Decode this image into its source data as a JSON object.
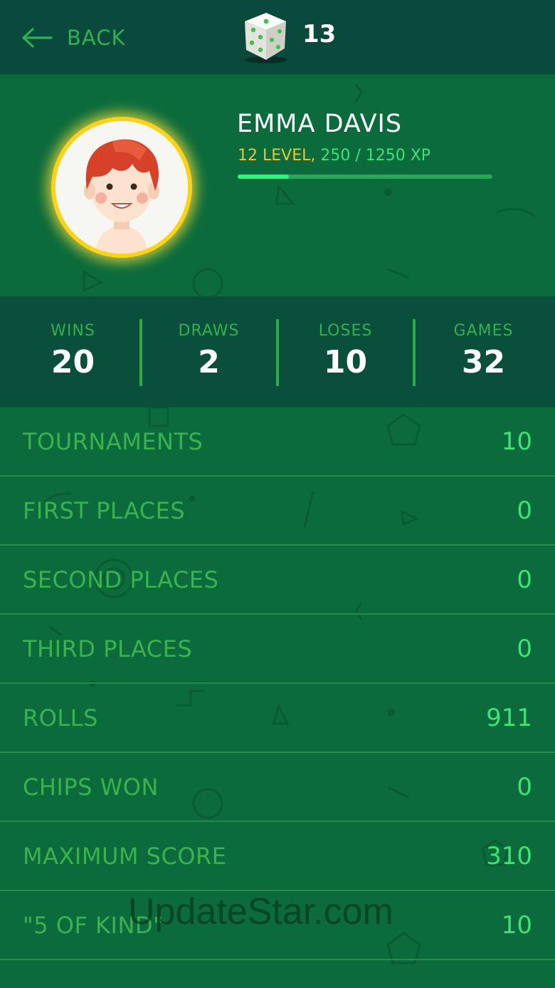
{
  "header": {
    "back_label": "BACK",
    "dice_count": "13"
  },
  "profile": {
    "name": "EMMA DAVIS",
    "level_text": "12 LEVEL",
    "separator": ",",
    "xp_text": "250 / 1250 XP",
    "xp_current": 250,
    "xp_max": 1250
  },
  "summary": [
    {
      "label": "WINS",
      "value": "20"
    },
    {
      "label": "DRAWS",
      "value": "2"
    },
    {
      "label": "LOSES",
      "value": "10"
    },
    {
      "label": "GAMES",
      "value": "32"
    }
  ],
  "stats": [
    {
      "label": "TOURNAMENTS",
      "value": "10"
    },
    {
      "label": "FIRST PLACES",
      "value": "0"
    },
    {
      "label": "SECOND PLACES",
      "value": "0"
    },
    {
      "label": "THIRD PLACES",
      "value": "0"
    },
    {
      "label": "ROLLS",
      "value": "911"
    },
    {
      "label": "CHIPS WON",
      "value": "0"
    },
    {
      "label": "MAXIMUM SCORE",
      "value": "310"
    },
    {
      "label": "\"5 OF KIND\"",
      "value": "10"
    }
  ],
  "watermark": "UpdateStar.com",
  "colors": {
    "background": "#0b6b3c",
    "header": "#0a4a3d",
    "accent_green": "#3de373",
    "label_green": "#3ab34e",
    "level_gold": "#e5c736",
    "avatar_ring": "#ffd21a"
  },
  "icons": {
    "back": "arrow-left-icon",
    "dice": "dice-icon",
    "avatar": "avatar-icon"
  }
}
